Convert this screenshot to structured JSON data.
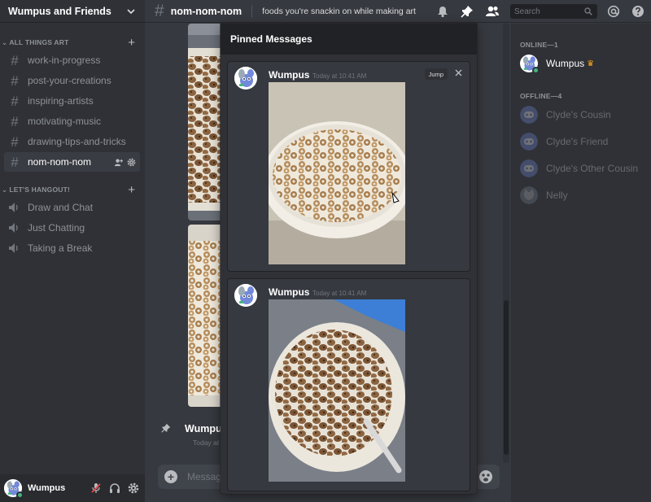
{
  "server": {
    "name": "Wumpus and Friends"
  },
  "sidebar": {
    "categories": [
      {
        "label": "ALL THINGS ART",
        "channels": [
          {
            "label": "work-in-progress"
          },
          {
            "label": "post-your-creations"
          },
          {
            "label": "inspiring-artists"
          },
          {
            "label": "motivating-music"
          },
          {
            "label": "drawing-tips-and-tricks"
          },
          {
            "label": "nom-nom-nom",
            "active": true
          }
        ]
      },
      {
        "label": "LET'S HANGOUT!",
        "channels": [
          {
            "label": "Draw and Chat"
          },
          {
            "label": "Just Chatting"
          },
          {
            "label": "Taking a Break"
          }
        ]
      }
    ]
  },
  "user_panel": {
    "username": "Wumpus",
    "status_color": "#43b581"
  },
  "topbar": {
    "channel": "nom-nom-nom",
    "topic": "foods you're snackin on while making art",
    "search_placeholder": "Search"
  },
  "chat": {
    "author": "Wumpus",
    "timestamp": "Today at",
    "input_placeholder": "Message #nom-nom-nom"
  },
  "pinned": {
    "title": "Pinned Messages",
    "jump_label": "Jump",
    "messages": [
      {
        "author": "Wumpus",
        "time": "Today at 10:41 AM",
        "image": "cereal-loops-photo"
      },
      {
        "author": "Wumpus",
        "time": "Today at 10:41 AM",
        "image": "chocolate-cereal-photo"
      }
    ]
  },
  "members": {
    "online_label": "ONLINE—1",
    "offline_label": "OFFLINE—4",
    "online": [
      {
        "name": "Wumpus",
        "crown": true
      }
    ],
    "offline": [
      {
        "name": "Clyde's Cousin"
      },
      {
        "name": "Clyde's Friend"
      },
      {
        "name": "Clyde's Other Cousin"
      },
      {
        "name": "Nelly"
      }
    ]
  },
  "colors": {
    "sidebar": "#2f3136",
    "main": "#36393f",
    "dark": "#202225",
    "online": "#43b581",
    "crown": "#faa61a",
    "brand": "#7289da"
  }
}
